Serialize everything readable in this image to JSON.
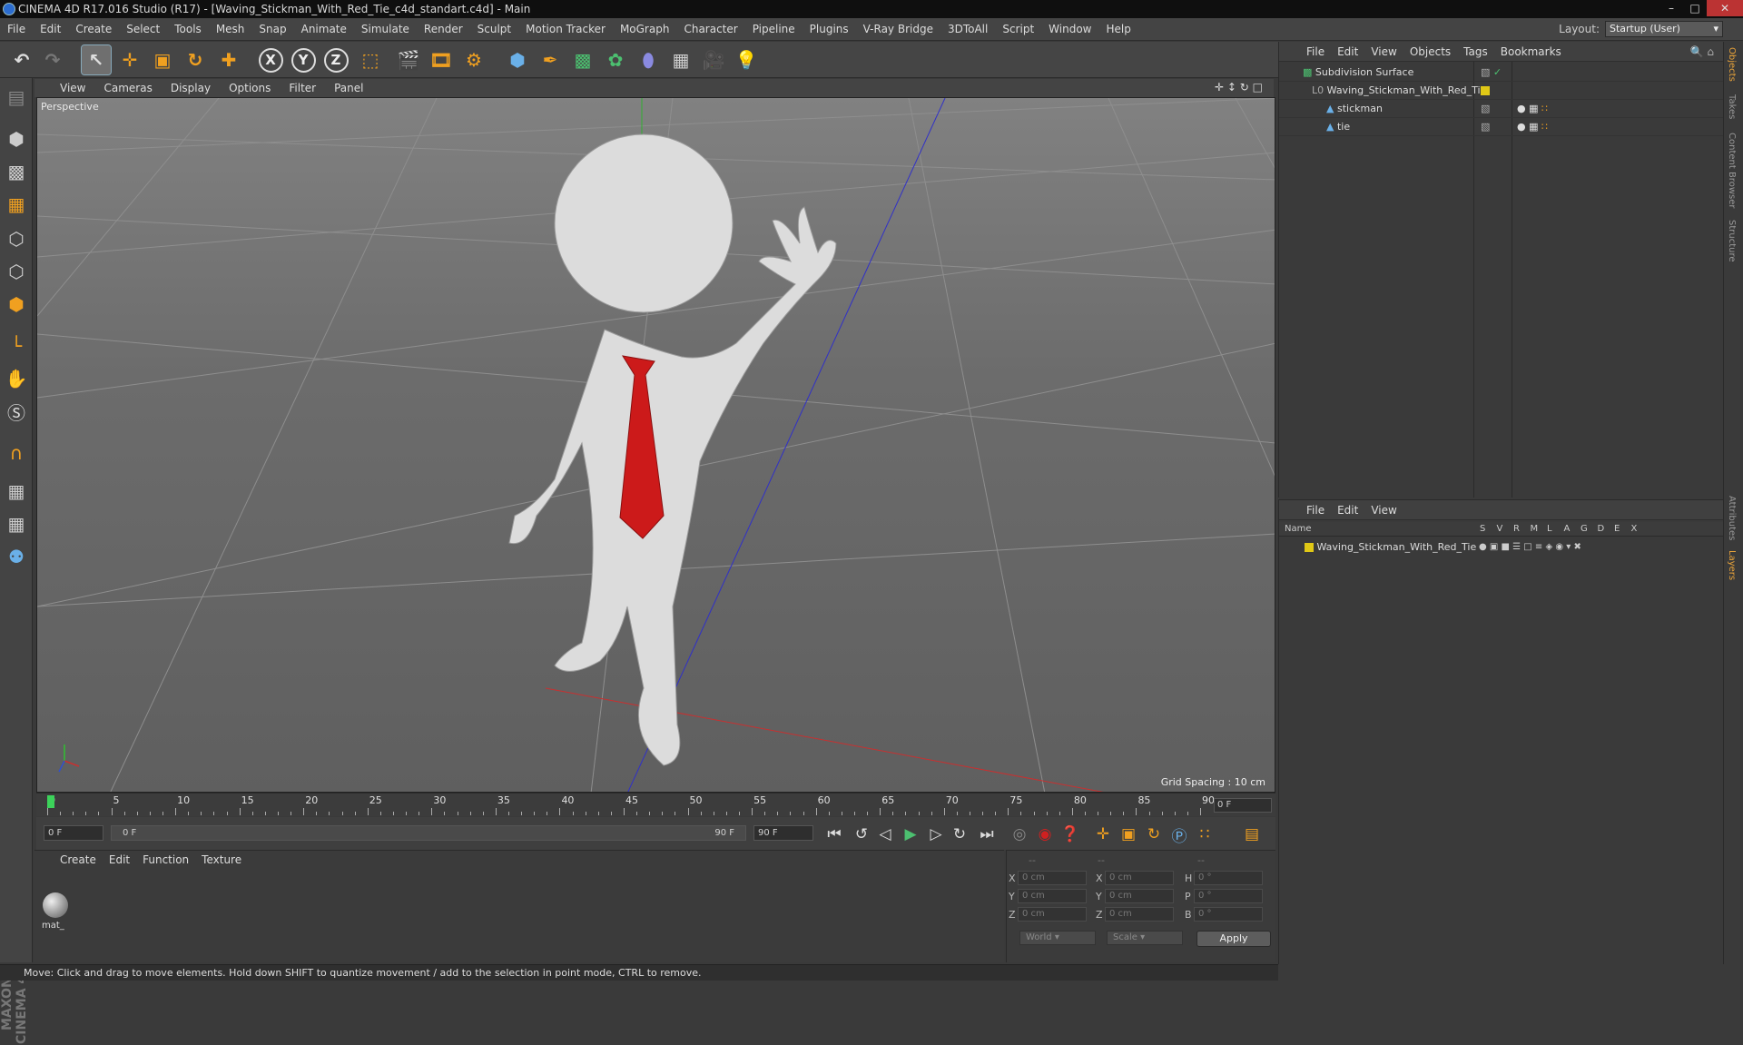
{
  "window": {
    "title": "CINEMA 4D R17.016 Studio (R17) - [Waving_Stickman_With_Red_Tie_c4d_standart.c4d] - Main"
  },
  "menubar": [
    "File",
    "Edit",
    "Create",
    "Select",
    "Tools",
    "Mesh",
    "Snap",
    "Animate",
    "Simulate",
    "Render",
    "Sculpt",
    "Motion Tracker",
    "MoGraph",
    "Character",
    "Pipeline",
    "Plugins",
    "V-Ray Bridge",
    "3DToAll",
    "Script",
    "Window",
    "Help"
  ],
  "layout": {
    "label": "Layout:",
    "value": "Startup (User)"
  },
  "toolbar": {
    "axis_x": "X",
    "axis_y": "Y",
    "axis_z": "Z"
  },
  "viewport": {
    "menu": [
      "View",
      "Cameras",
      "Display",
      "Options",
      "Filter",
      "Panel"
    ],
    "label": "Perspective",
    "grid_spacing": "Grid Spacing : 10 cm"
  },
  "timeline": {
    "ticks": [
      "0",
      "5",
      "10",
      "15",
      "20",
      "25",
      "30",
      "35",
      "40",
      "45",
      "50",
      "55",
      "60",
      "65",
      "70",
      "75",
      "80",
      "85",
      "90"
    ],
    "current": "0 F",
    "start_field": "0 F",
    "range_start": "0 F",
    "range_end": "90 F",
    "end_field": "90 F"
  },
  "materials": {
    "menu": [
      "Create",
      "Edit",
      "Function",
      "Texture"
    ],
    "items": [
      {
        "label": "mat_"
      }
    ]
  },
  "coords": {
    "header_a": "--",
    "header_b": "--",
    "header_c": "--",
    "rows": [
      {
        "a": "X",
        "av": "0 cm",
        "b": "X",
        "bv": "0 cm",
        "c": "H",
        "cv": "0 °"
      },
      {
        "a": "Y",
        "av": "0 cm",
        "b": "Y",
        "bv": "0 cm",
        "c": "P",
        "cv": "0 °"
      },
      {
        "a": "Z",
        "av": "0 cm",
        "b": "Z",
        "bv": "0 cm",
        "c": "B",
        "cv": "0 °"
      }
    ],
    "world": "World",
    "scale": "Scale",
    "apply": "Apply"
  },
  "status": "Move: Click and drag to move elements. Hold down SHIFT to quantize movement / add to the selection in point mode, CTRL to remove.",
  "objects": {
    "menu": [
      "File",
      "Edit",
      "View",
      "Objects",
      "Tags",
      "Bookmarks"
    ],
    "items": [
      {
        "name": "Subdivision Surface"
      },
      {
        "name": "Waving_Stickman_With_Red_Tie"
      },
      {
        "name": "stickman"
      },
      {
        "name": "tie"
      }
    ]
  },
  "layers": {
    "menu": [
      "File",
      "Edit",
      "View"
    ],
    "header": {
      "name": "Name",
      "cols": [
        "S",
        "V",
        "R",
        "M",
        "L",
        "A",
        "G",
        "D",
        "E",
        "X"
      ]
    },
    "items": [
      {
        "name": "Waving_Stickman_With_Red_Tie"
      }
    ]
  },
  "side_tabs": [
    "Objects",
    "Takes",
    "Content Browser",
    "Structure",
    "Attributes",
    "Layers"
  ],
  "brand": "MAXON CINEMA 4D",
  "colors": {
    "tie": "#cc1a1a",
    "layer": "#e0c816",
    "accent": "#e8a33a"
  }
}
